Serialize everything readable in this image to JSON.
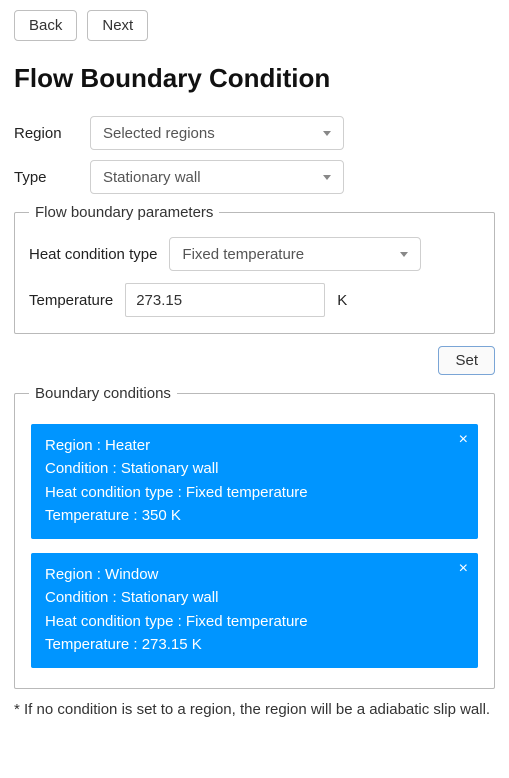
{
  "nav": {
    "back_label": "Back",
    "next_label": "Next"
  },
  "title": "Flow Boundary Condition",
  "region_row": {
    "label": "Region",
    "value": "Selected regions"
  },
  "type_row": {
    "label": "Type",
    "value": "Stationary wall"
  },
  "params": {
    "legend": "Flow boundary parameters",
    "heat_cond_label": "Heat condition type",
    "heat_cond_value": "Fixed temperature",
    "temp_label": "Temperature",
    "temp_value": "273.15",
    "temp_unit": "K"
  },
  "set_label": "Set",
  "conditions": {
    "legend": "Boundary conditions",
    "items": [
      {
        "region_line": "Region : Heater",
        "condition_line": "Condition : Stationary wall",
        "heat_line": "Heat condition type : Fixed temperature",
        "temp_line": "Temperature : 350 K"
      },
      {
        "region_line": "Region : Window",
        "condition_line": "Condition : Stationary wall",
        "heat_line": "Heat condition type : Fixed temperature",
        "temp_line": "Temperature : 273.15 K"
      }
    ]
  },
  "footnote": "* If no condition is set to a region, the region will be a adiabatic slip wall."
}
